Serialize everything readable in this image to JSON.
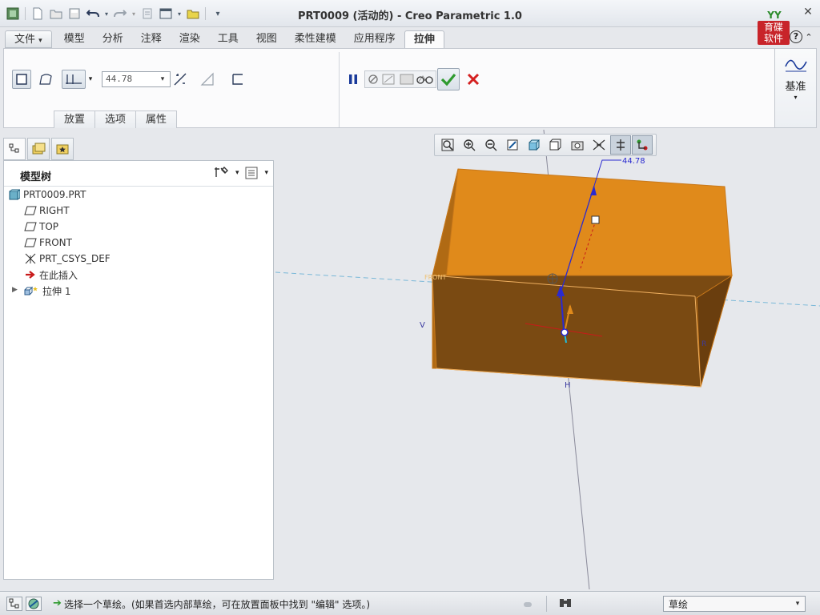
{
  "window": {
    "title": "PRT0009 (活动的) - Creo Parametric 1.0",
    "logo_top": "YY",
    "logo_line1": "育碟",
    "logo_line2": "软件"
  },
  "quick_access": [
    "new-icon",
    "open-icon",
    "save-icon",
    "undo-icon",
    "redo-icon",
    "regenerate-icon",
    "windows-icon",
    "close-window-icon",
    "customize-icon"
  ],
  "ribbon": {
    "tabs": [
      {
        "label": "文件",
        "kind": "file"
      },
      {
        "label": "模型"
      },
      {
        "label": "分析"
      },
      {
        "label": "注释"
      },
      {
        "label": "渲染"
      },
      {
        "label": "工具"
      },
      {
        "label": "视图"
      },
      {
        "label": "柔性建模"
      },
      {
        "label": "应用程序"
      },
      {
        "label": "拉伸",
        "active": true
      }
    ],
    "file_arrow": "▾",
    "depth_value": "44.78",
    "subtabs": [
      "放置",
      "选项",
      "属性"
    ],
    "datum_label": "基准"
  },
  "model_tree": {
    "title": "模型树",
    "items": [
      {
        "label": "PRT0009.PRT",
        "icon": "part-icon"
      },
      {
        "label": "RIGHT",
        "icon": "datum-plane-icon"
      },
      {
        "label": "TOP",
        "icon": "datum-plane-icon"
      },
      {
        "label": "FRONT",
        "icon": "datum-plane-icon"
      },
      {
        "label": "PRT_CSYS_DEF",
        "icon": "csys-icon"
      },
      {
        "label": "在此插入",
        "icon": "insert-arrow-icon"
      },
      {
        "label": "拉伸 1",
        "icon": "extrude-icon"
      }
    ]
  },
  "graphics": {
    "dimension_label": "44.78",
    "label_v": "V",
    "label_h": "H",
    "label_front": "FRONT",
    "label_r": "R"
  },
  "status": {
    "message": "选择一个草绘。(如果首选内部草绘，可在放置面板中找到 \"编辑\" 选项。)",
    "filter": "草绘"
  },
  "colors": {
    "extrude_top": "#e08a1b",
    "extrude_front": "#7a4a12",
    "extrude_edge": "#c8781a",
    "dimension_blue": "#2a2ad0",
    "confirm_green": "#2e9a2e",
    "cancel_red": "#d42020"
  }
}
